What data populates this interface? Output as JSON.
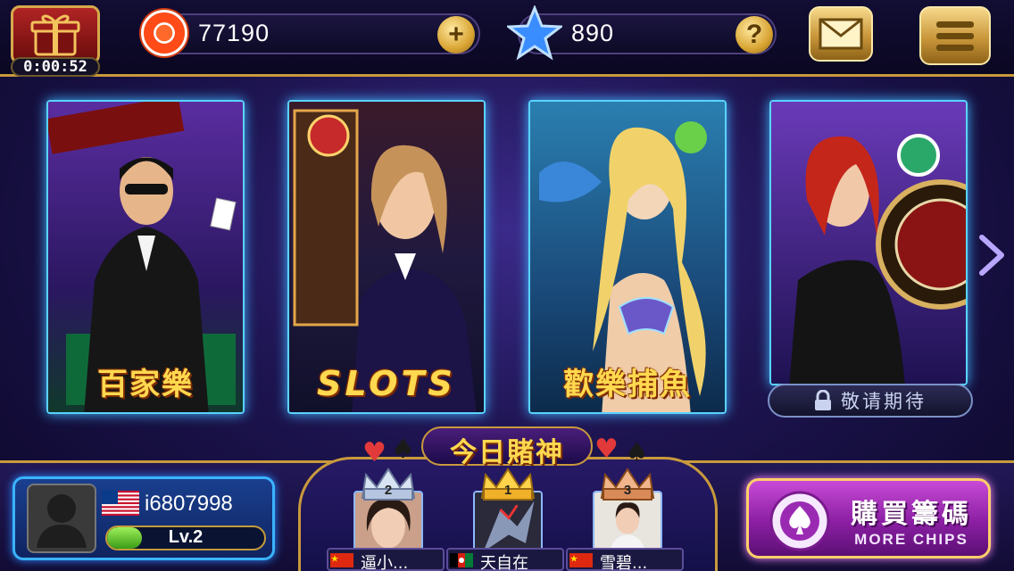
{
  "top_bar": {
    "timer": "0:00:52",
    "chips": "77190",
    "stars": "890",
    "icons": [
      "gift-icon",
      "chip-icon",
      "plus-icon",
      "star-icon",
      "help-icon",
      "mail-icon",
      "menu-icon"
    ]
  },
  "games": [
    {
      "title": "百家樂",
      "art": "baccarat-dealer",
      "accent": "#ffd94f"
    },
    {
      "title": "SLOTS",
      "art": "slots-hostess",
      "accent": "#ffd94f"
    },
    {
      "title": "歡樂捕魚",
      "art": "mermaid-fishing",
      "accent": "#ffd94f"
    },
    {
      "title": "",
      "art": "roulette-hostess",
      "locked_label": "敬请期待"
    }
  ],
  "player": {
    "id": "i6807998",
    "level": "Lv.2",
    "level_progress": 0.22,
    "flag": "us-flag"
  },
  "gamblers": {
    "title": "今日賭神",
    "ranks": [
      {
        "rank": "2",
        "name": "逼小...",
        "flag": "cn-flag",
        "crown": "silver"
      },
      {
        "rank": "1",
        "name": "天自在",
        "flag": "af-flag",
        "crown": "gold"
      },
      {
        "rank": "3",
        "name": "雪碧...",
        "flag": "cn-flag",
        "crown": "bronze"
      }
    ]
  },
  "buy": {
    "label_cn": "購買籌碼",
    "label_en": "MORE CHIPS"
  }
}
